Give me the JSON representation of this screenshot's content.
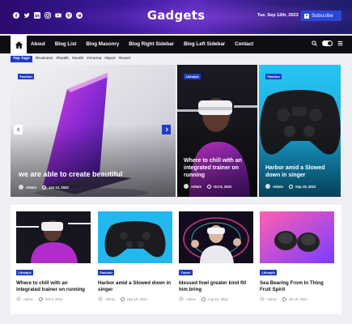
{
  "header": {
    "socials": [
      "facebook-icon",
      "twitter-icon",
      "linkedin-icon",
      "instagram-icon",
      "youtube-icon",
      "pinterest-icon",
      "telegram-icon"
    ],
    "site_title": "Gadgets",
    "date": "Tue. Sep 12th, 2023",
    "subscribe_label": "Subscribe"
  },
  "nav": {
    "items": [
      "About",
      "Blog List",
      "Blog Masonry",
      "Blog Right Sidebar",
      "Blog Left Sidebar",
      "Contact"
    ]
  },
  "tags": {
    "label": "Top Tags",
    "items": [
      "#business",
      "#health",
      "#world",
      "#cinema",
      "#sport",
      "#travel"
    ]
  },
  "hero": {
    "main": {
      "category": "Fashion",
      "title": "we are able to create beautiful",
      "author": "Admin",
      "date": "Jan 12, 2020"
    },
    "second": {
      "category": "Lifestyle",
      "title": "Where to chill with an integrated trainer on running",
      "author": "Admin",
      "date": "Oct 5, 2022"
    },
    "third": {
      "category": "Fashion",
      "title": "Harbor amid a Slowed down in singer",
      "author": "Admin",
      "date": "Sep 19, 2022"
    }
  },
  "cards": [
    {
      "category": "Lifestyle",
      "title": "Where to chill with an integrated trainer on running",
      "author": "Admin",
      "date": "Oct 5, 2022"
    },
    {
      "category": "Fashion",
      "title": "Harbor amid a Slowed down in singer",
      "author": "Admin",
      "date": "Sep 19, 2022"
    },
    {
      "category": "Travel",
      "title": "blessed fowl greater kind fill him bring",
      "author": "Admin",
      "date": "Aug 16, 2022"
    },
    {
      "category": "Lifestyle",
      "title": "Sea Bearing From In Thing Fruit Spirit",
      "author": "Admin",
      "date": "Jul 19, 2022"
    }
  ],
  "colors": {
    "accent": "#1f3cc9",
    "nav_bg": "#0e0e12",
    "page_bg": "#eef0f4"
  }
}
